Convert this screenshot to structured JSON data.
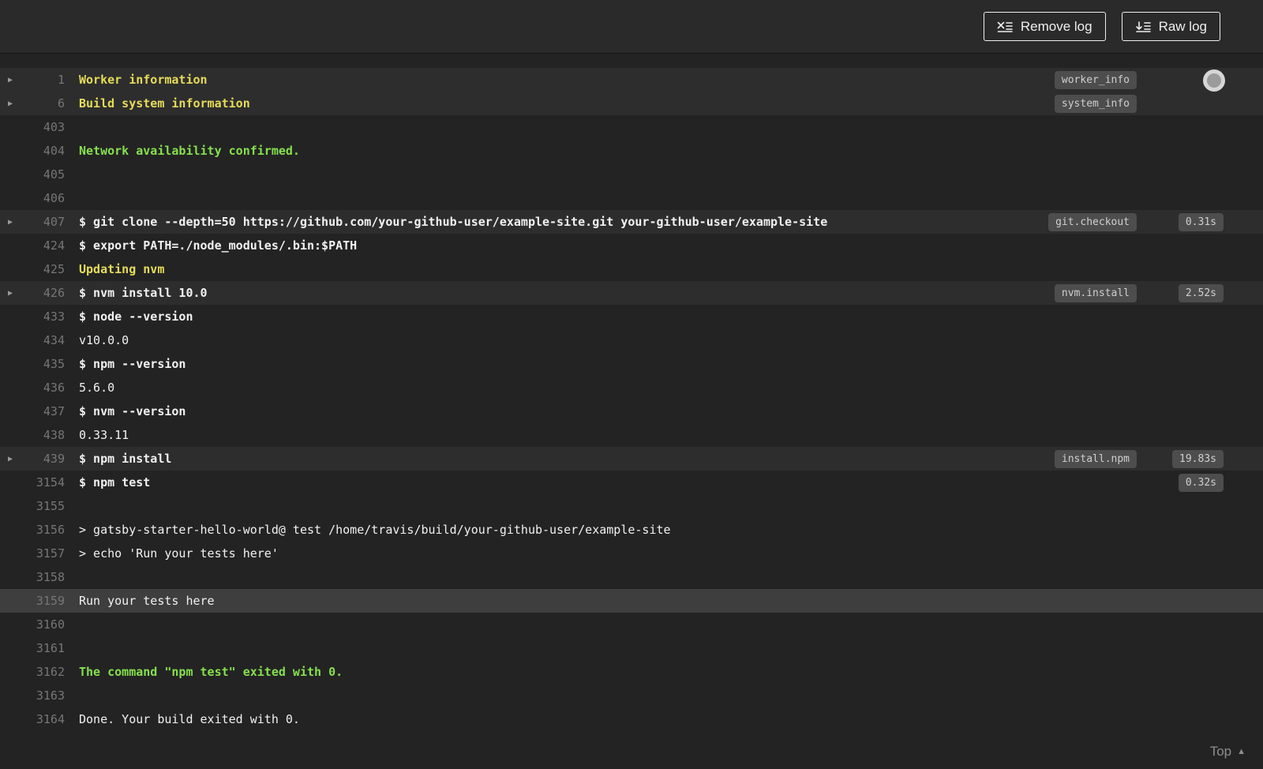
{
  "header": {
    "remove_log": "Remove log",
    "raw_log": "Raw log"
  },
  "icons": {
    "fold_arrow": "▶",
    "top_caret": "▲"
  },
  "footer": {
    "top": "Top"
  },
  "colors": {
    "background": "#232323",
    "header_background": "#2a2a2a",
    "text": "#f1f1f1",
    "yellow": "#e5dc59",
    "green": "#86e04e",
    "badge_background": "#4d4d4d",
    "fold_row_background": "#2d2d2d",
    "highlight_row_background": "#3e3e3e"
  },
  "log": {
    "lines": [
      {
        "number": "1",
        "text": "Worker information",
        "color": "yellow",
        "fold": true,
        "badge": "worker_info"
      },
      {
        "number": "6",
        "text": "Build system information",
        "color": "yellow",
        "fold": true,
        "badge": "system_info"
      },
      {
        "number": "403",
        "text": ""
      },
      {
        "number": "404",
        "text": "Network availability confirmed.",
        "color": "green"
      },
      {
        "number": "405",
        "text": ""
      },
      {
        "number": "406",
        "text": ""
      },
      {
        "number": "407",
        "text": "$ git clone --depth=50 https://github.com/your-github-user/example-site.git your-github-user/example-site",
        "bold": true,
        "fold": true,
        "badge": "git.checkout",
        "time": "0.31s"
      },
      {
        "number": "424",
        "text": "$ export PATH=./node_modules/.bin:$PATH",
        "bold": true
      },
      {
        "number": "425",
        "text": "Updating nvm",
        "color": "yellow"
      },
      {
        "number": "426",
        "text": "$ nvm install 10.0",
        "bold": true,
        "fold": true,
        "badge": "nvm.install",
        "time": "2.52s"
      },
      {
        "number": "433",
        "text": "$ node --version",
        "bold": true
      },
      {
        "number": "434",
        "text": "v10.0.0"
      },
      {
        "number": "435",
        "text": "$ npm --version",
        "bold": true
      },
      {
        "number": "436",
        "text": "5.6.0"
      },
      {
        "number": "437",
        "text": "$ nvm --version",
        "bold": true
      },
      {
        "number": "438",
        "text": "0.33.11"
      },
      {
        "number": "439",
        "text": "$ npm install",
        "bold": true,
        "fold": true,
        "badge": "install.npm",
        "time": "19.83s"
      },
      {
        "number": "3154",
        "text": "$ npm test",
        "bold": true,
        "time": "0.32s"
      },
      {
        "number": "3155",
        "text": ""
      },
      {
        "number": "3156",
        "text": "> gatsby-starter-hello-world@ test /home/travis/build/your-github-user/example-site"
      },
      {
        "number": "3157",
        "text": "> echo 'Run your tests here'"
      },
      {
        "number": "3158",
        "text": ""
      },
      {
        "number": "3159",
        "text": "Run your tests here",
        "highlight": true
      },
      {
        "number": "3160",
        "text": ""
      },
      {
        "number": "3161",
        "text": ""
      },
      {
        "number": "3162",
        "text": "The command \"npm test\" exited with 0.",
        "color": "green"
      },
      {
        "number": "3163",
        "text": ""
      },
      {
        "number": "3164",
        "text": "Done. Your build exited with 0."
      }
    ]
  }
}
